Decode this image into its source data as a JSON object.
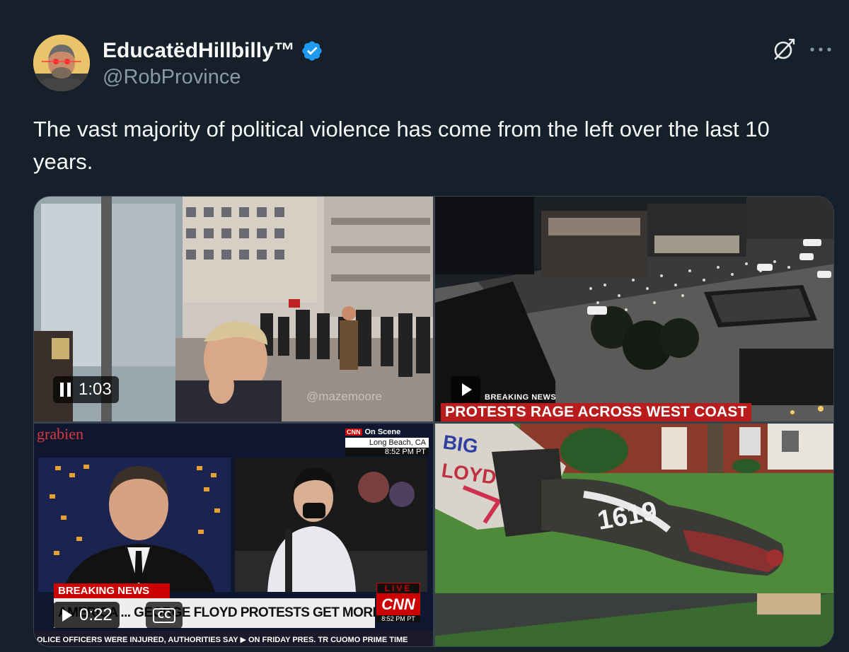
{
  "author": {
    "display_name": "EducatëdHillbilly™",
    "handle": "@RobProvince",
    "verified": true,
    "avatar_icon": "profile-avatar-laser-eyes"
  },
  "actions": {
    "grok_icon": "grok-icon",
    "more_icon": "more-icon"
  },
  "tweet": {
    "text": "The vast majority of political violence has come from the left over the last 10 years."
  },
  "media": [
    {
      "kind": "video",
      "playing": true,
      "duration": "1:03",
      "watermark": "@mazemoore"
    },
    {
      "kind": "video",
      "playing": false,
      "chyron_small": "BREAKING NEWS",
      "chyron_big": "PROTESTS RAGE ACROSS WEST COAST"
    },
    {
      "kind": "video",
      "playing": false,
      "duration": "0:22",
      "source_watermark": "grabien",
      "on_scene_label": "On Scene",
      "on_scene_location": "Long Beach, CA",
      "on_scene_time": "8:52 PM PT",
      "breaking": "BREAKING NEWS",
      "headline": "AMERICA ... GEORGE FLOYD PROTESTS GET MORE VIOLENT",
      "live_label": "LIVE",
      "network": "CNN",
      "live_time": "8:52 PM PT",
      "ticker": "OLICE OFFICERS WERE INJURED, AUTHORITIES SAY   ▶   ON FRIDAY PRES. TR  CUOMO PRIME TIME"
    },
    {
      "kind": "image",
      "graffiti_1": "BIG FLOYD",
      "graffiti_2": "1619"
    }
  ],
  "colors": {
    "background": "#15202b",
    "text_primary": "#f7f9f9",
    "text_secondary": "#8b98a5",
    "verified_blue": "#1d9bf0",
    "cnn_red": "#cc0000"
  }
}
